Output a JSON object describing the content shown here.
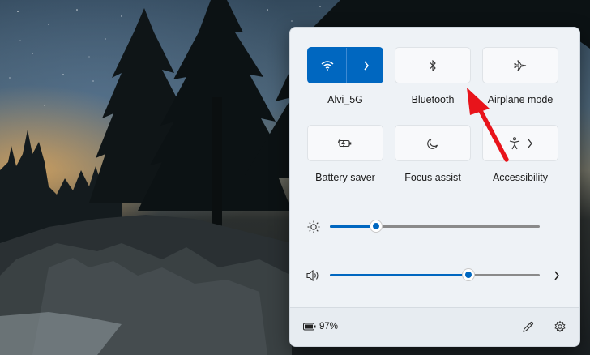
{
  "quick_settings": {
    "tiles": [
      {
        "label": "Alvi_5G",
        "icon": "wifi-icon",
        "active": true,
        "has_expand": true
      },
      {
        "label": "Bluetooth",
        "icon": "bluetooth-icon",
        "active": false
      },
      {
        "label": "Airplane mode",
        "icon": "airplane-icon",
        "active": false
      },
      {
        "label": "Battery saver",
        "icon": "battery-saver-icon",
        "active": false
      },
      {
        "label": "Focus assist",
        "icon": "moon-icon",
        "active": false
      },
      {
        "label": "Accessibility",
        "icon": "accessibility-icon",
        "active": false,
        "has_expand": true
      }
    ],
    "brightness": {
      "icon": "sun-icon",
      "level": 0.22
    },
    "volume": {
      "icon": "speaker-icon",
      "level": 0.66,
      "has_expand": true
    },
    "footer": {
      "battery_icon": "battery-icon",
      "battery_percent": "97%",
      "edit_icon": "pencil-icon",
      "settings_icon": "gear-icon"
    }
  },
  "colors": {
    "accent": "#0067c0",
    "annotation_arrow": "#e8141b"
  }
}
